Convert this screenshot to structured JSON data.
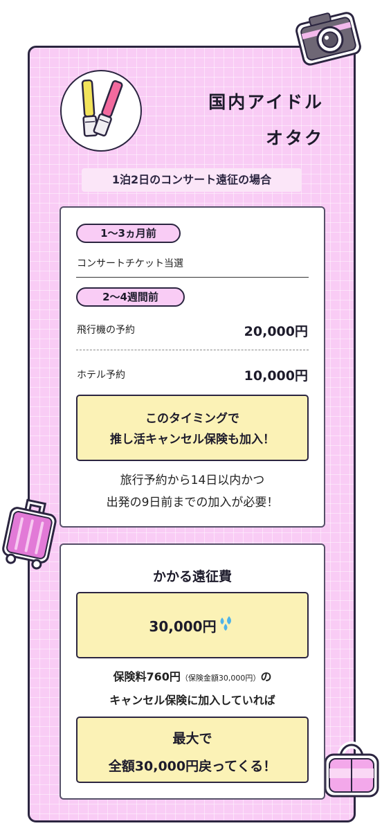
{
  "header": {
    "title_line1": "国内アイドル",
    "title_line2": "オタク",
    "subtitle": "1泊2日のコンサート遠征の場合"
  },
  "timeline": {
    "step1": {
      "badge": "1〜3ヵ月前",
      "item": "コンサートチケット当選"
    },
    "step2": {
      "badge": "2〜4週間前",
      "items": [
        {
          "label": "飛行機の予約",
          "price": "20,000円"
        },
        {
          "label": "ホテル予約",
          "price": "10,000円"
        }
      ]
    },
    "callout": {
      "line1": "このタイミングで",
      "line2": "推し活キャンセル保険も加入！"
    },
    "note": {
      "line1": "旅行予約から14日以内かつ",
      "line2": "出発の9日前までの加入が必要！"
    }
  },
  "cost": {
    "title": "かかる遠征費",
    "amount": "30,000円",
    "premium_prefix": "保険料760円",
    "premium_paren": "（保険金額30,000円）",
    "premium_suffix": "の",
    "line2": "キャンセル保険に加入していれば",
    "result_line1": "最大で",
    "result_line2": "全額30,000円戻ってくる！"
  },
  "colors": {
    "background": "#f9ccf5",
    "card": "#ffffff",
    "highlight": "#fbf2b6",
    "border": "#2b2540"
  },
  "icons": [
    "penlight-icon",
    "camera-icon",
    "suitcase-icon",
    "bag-icon",
    "sweat-drops-icon"
  ]
}
